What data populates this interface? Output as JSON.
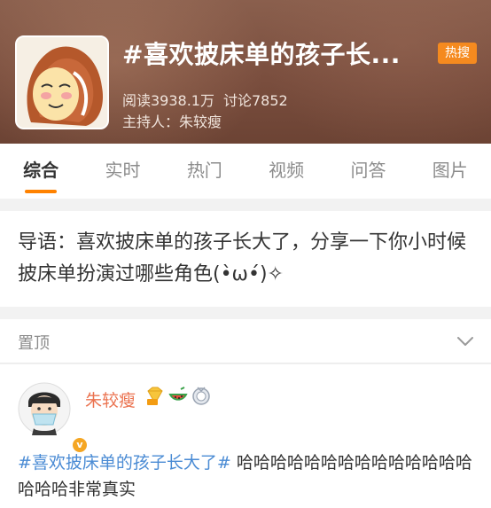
{
  "topic": {
    "title": "#喜欢披床单的孩子长...",
    "badge": "热搜",
    "reads": "阅读3938.1万",
    "discussions": "讨论7852",
    "host": "主持人：朱较瘦"
  },
  "tabs": [
    {
      "label": "综合",
      "active": true
    },
    {
      "label": "实时",
      "active": false
    },
    {
      "label": "热门",
      "active": false
    },
    {
      "label": "视频",
      "active": false
    },
    {
      "label": "问答",
      "active": false
    },
    {
      "label": "图片",
      "active": false
    }
  ],
  "intro": {
    "text": "导语：喜欢披床单的孩子长大了，分享一下你小时候披床单扮演过哪些角色(•̀ω•́)✧"
  },
  "pinned": {
    "label": "置顶",
    "icon": "chevron-down-icon"
  },
  "post": {
    "author": "朱较瘦",
    "verified_badge": "v",
    "medals": [
      "diamond-vip-icon",
      "watermelon-icon",
      "medal-icon"
    ],
    "hashtag": "#喜欢披床单的孩子长大了#",
    "body": " 哈哈哈哈哈哈哈哈哈哈哈哈哈哈哈哈哈非常真实"
  },
  "colors": {
    "accent": "#ff8200",
    "badge": "#f58a1f",
    "author": "#eb7350",
    "link": "#4a8bd4"
  }
}
